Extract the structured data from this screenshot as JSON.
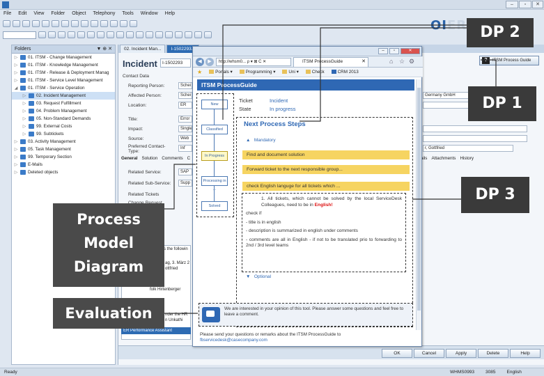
{
  "app": {
    "menu": [
      "File",
      "Edit",
      "View",
      "Folder",
      "Object",
      "Telephony",
      "Tools",
      "Window",
      "Help"
    ],
    "brand_text": "OI",
    "brand_faded": "ER"
  },
  "folders": {
    "header": "Folders",
    "header_controls": "▼  ⊕  ✕",
    "items": [
      {
        "label": "01. ITSM - Change Management",
        "level": 0
      },
      {
        "label": "01. ITSM - Knowledge Management",
        "level": 0
      },
      {
        "label": "01. ITSM - Release & Deployment Manag",
        "level": 0
      },
      {
        "label": "01. ITSM - Service Level Management",
        "level": 0
      },
      {
        "label": "01. ITSM - Service Operation",
        "level": 0,
        "expanded": true
      },
      {
        "label": "02. Incident Management",
        "level": 1,
        "selected": true
      },
      {
        "label": "03. Request Fulfillment",
        "level": 1
      },
      {
        "label": "04. Problem Management",
        "level": 1
      },
      {
        "label": "05. Non-Standard Demands",
        "level": 1
      },
      {
        "label": "99. External Costs",
        "level": 1
      },
      {
        "label": "99. Subtickets",
        "level": 1
      },
      {
        "label": "03. Activity Management",
        "level": 0
      },
      {
        "label": "05. Task Management",
        "level": 0
      },
      {
        "label": "99. Temporary Section",
        "level": 0
      },
      {
        "label": "E-Mails",
        "level": 0
      },
      {
        "label": "Deleted objects",
        "level": 0
      }
    ]
  },
  "form": {
    "tabs": [
      "02. Incident Man...",
      "I-1502293..."
    ],
    "title": "Incident",
    "id_value": "I-1502293",
    "contact_data": "Contact Data",
    "reporting_person_label": "Reporting Person:",
    "reporting_person_value": "Schei",
    "affected_person_label": "Affected Person:",
    "affected_person_value": "Schei",
    "location_label": "Location:",
    "location_value": "ER",
    "title_label": "Title:",
    "title_value": "Error",
    "impact_label": "Impact:",
    "impact_value": "Single",
    "source_label": "Source:",
    "source_value": "Web",
    "pref_contact_label": "Preferred Contact-Type:",
    "pref_contact_value": "Inf",
    "company_value": "Germany GmbH",
    "owner_value": "r, Gottfried",
    "subtabs": [
      "General",
      "Solution",
      "Comments",
      "C"
    ],
    "right_tabs": [
      "ails",
      "Attachments",
      "History"
    ],
    "related_service_label": "Related Service:",
    "related_service_value": "SAP",
    "related_subservice_label": "Related Sub-Service:",
    "related_subservice_value": "Supp",
    "related_tickets": "Related Tickets",
    "change_request": "Change Request",
    "info_text_1": "s the followin",
    "info_text_2": "ag, 3. März 2",
    "info_text_3": "ottfried",
    "info_text_4": "folk Hirtenberger",
    "info_text_5": "nder the HR",
    "info_text_6": "n Unkathi",
    "perf_text": "ER Performance Assistant",
    "pm_button_icon": "?",
    "pm_button": "ITSM Process Guide",
    "buttons": {
      "ok": "OK",
      "cancel": "Cancel",
      "apply": "Apply",
      "delete": "Delete",
      "help": "Help"
    }
  },
  "browser": {
    "url": "http://whsm0... ρ ▾ ⊠ C ✕",
    "tab_title": "ITSM ProcessGuide",
    "favorites": [
      "Portals ▾",
      "Programming ▾",
      "Uni ▾",
      "Check",
      "CRM 2013"
    ],
    "header": "ITSM ProcessGuide"
  },
  "guide": {
    "diagram_nodes": [
      "New",
      "Classified",
      "In Progress",
      "Processing in ...",
      "Solved"
    ],
    "active_node": "In Progress",
    "ticket_label": "Ticket",
    "ticket_value": "Incident",
    "state_label": "State",
    "state_value": "In progress",
    "next_steps_title": "Next Process Steps",
    "mandatory_label": "Mandatory",
    "steps": [
      "Find and document solution",
      "Forward ticket to the next responsible group...",
      "check English languge for all tickets which ..."
    ],
    "detail_item1_a": "1.  All tickets, which cannot be solved by the local ServiceDesk Colleagues, need to be in",
    "detail_item1_b": "English!",
    "detail_check": "check if",
    "detail_p1": "- title is in english",
    "detail_p2": "- description is summarized in english under comments",
    "detail_p3": "- comments are all in English - if not to be translated prio to forwarding to 2nd / 3rd level teams",
    "optional_label": "Optional",
    "evaluation_text": "We are interested in your opinion of this tool. Please answer some questions and feel free to leave a comment.",
    "send_text": "Please send your questions or remarks about the ITSM ProcessGuide to",
    "send_mail": "fbservicedesk@casecompany.com"
  },
  "callouts": {
    "dp1": "DP 1",
    "dp2": "DP 2",
    "dp3": "DP 3",
    "process_model": "Process Model Diagram",
    "evaluation": "Evaluation"
  },
  "statusbar": {
    "left": "Ready",
    "right": [
      "WHMS0993",
      "3085",
      "English"
    ]
  },
  "colors": {
    "accent_blue": "#2f68b4",
    "step_yellow": "#f6d461",
    "callout_gray": "#3a3a3a"
  }
}
